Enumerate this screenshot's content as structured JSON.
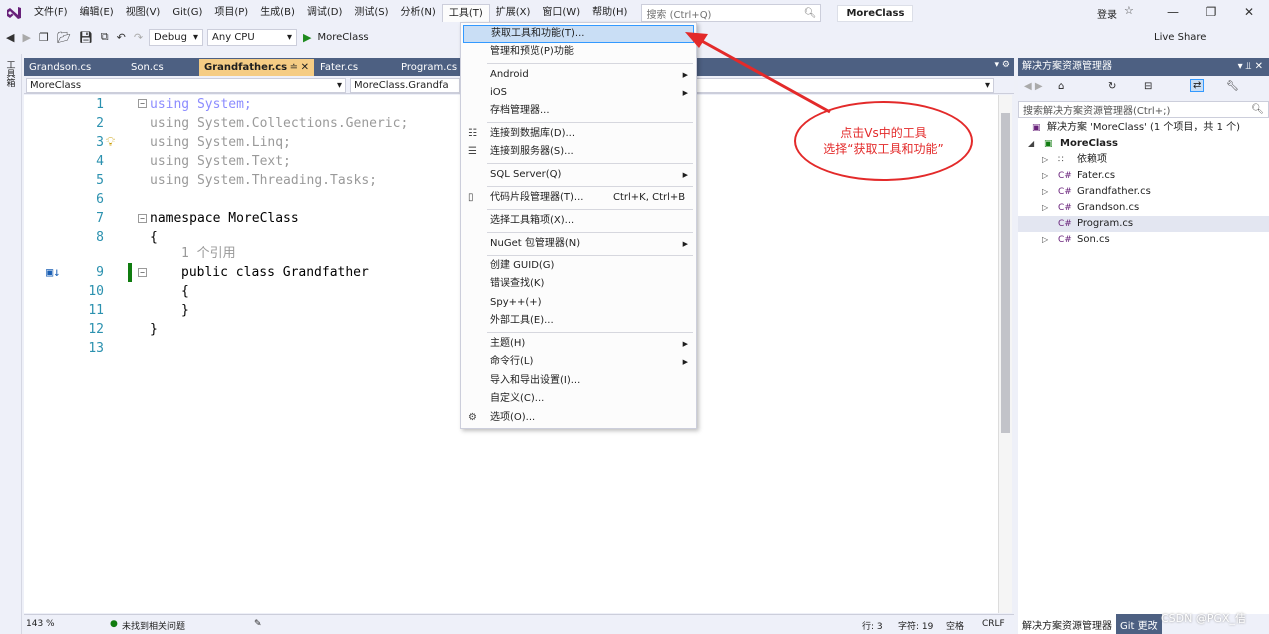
{
  "menubar": {
    "items": [
      "文件(F)",
      "编辑(E)",
      "视图(V)",
      "Git(G)",
      "项目(P)",
      "生成(B)",
      "调试(D)",
      "测试(S)",
      "分析(N)",
      "工具(T)",
      "扩展(X)",
      "窗口(W)",
      "帮助(H)"
    ],
    "search_placeholder": "搜索 (Ctrl+Q)",
    "solution_name": "MoreClass",
    "login": "登录"
  },
  "toolbar": {
    "config": "Debug",
    "platform": "Any CPU",
    "run_target": "MoreClass",
    "live_share": "Live Share"
  },
  "left_strip": {
    "label": "工具箱"
  },
  "editor": {
    "tabs": [
      "Grandson.cs",
      "Son.cs",
      "Grandfather.cs",
      "Fater.cs",
      "Program.cs"
    ],
    "active_tab": "Grandfather.cs",
    "nav_left": "MoreClass",
    "nav_middle": "MoreClass.Grandfa",
    "lines": [
      {
        "no": "1",
        "text": "using System;"
      },
      {
        "no": "2",
        "text": "using System.Collections.Generic;"
      },
      {
        "no": "3",
        "text": "using System.Linq;"
      },
      {
        "no": "4",
        "text": "using System.Text;"
      },
      {
        "no": "5",
        "text": "using System.Threading.Tasks;"
      },
      {
        "no": "6",
        "text": ""
      },
      {
        "no": "7",
        "text": "namespace MoreClass"
      },
      {
        "no": "8",
        "text": "{"
      },
      {
        "no": "",
        "text": "1 个引用"
      },
      {
        "no": "9",
        "text": "public class Grandfather"
      },
      {
        "no": "10",
        "text": "{"
      },
      {
        "no": "11",
        "text": "}"
      },
      {
        "no": "12",
        "text": "}"
      },
      {
        "no": "13",
        "text": ""
      }
    ]
  },
  "status": {
    "zoom": "143 %",
    "issues": "未找到相关问题",
    "line": "行: 3",
    "col": "字符: 19",
    "spaces": "空格",
    "eol": "CRLF"
  },
  "solution_explorer": {
    "title": "解决方案资源管理器",
    "search_placeholder": "搜索解决方案资源管理器(Ctrl+;)",
    "tree": [
      {
        "label": "解决方案 'MoreClass' (1 个项目，共 1 个)",
        "level": 0
      },
      {
        "label": "MoreClass",
        "level": 1
      },
      {
        "label": "依赖项",
        "level": 2
      },
      {
        "label": "Fater.cs",
        "level": 2
      },
      {
        "label": "Grandfather.cs",
        "level": 2
      },
      {
        "label": "Grandson.cs",
        "level": 2
      },
      {
        "label": "Program.cs",
        "level": 2
      },
      {
        "label": "Son.cs",
        "level": 2
      }
    ],
    "bottom_tabs": [
      "解决方案资源管理器",
      "Git 更改"
    ]
  },
  "tools_menu": {
    "items": [
      {
        "label": "获取工具和功能(T)...",
        "shortcut": "",
        "submenu": false
      },
      {
        "label": "管理和预览(P)功能",
        "shortcut": "",
        "submenu": false
      },
      {
        "label": "Android",
        "shortcut": "",
        "submenu": true
      },
      {
        "label": "iOS",
        "shortcut": "",
        "submenu": true
      },
      {
        "label": "存档管理器...",
        "shortcut": "",
        "submenu": false
      },
      {
        "label": "连接到数据库(D)...",
        "shortcut": "",
        "submenu": false
      },
      {
        "label": "连接到服务器(S)...",
        "shortcut": "",
        "submenu": false
      },
      {
        "label": "SQL Server(Q)",
        "shortcut": "",
        "submenu": true
      },
      {
        "label": "代码片段管理器(T)...",
        "shortcut": "Ctrl+K, Ctrl+B",
        "submenu": false
      },
      {
        "label": "选择工具箱项(X)...",
        "shortcut": "",
        "submenu": false
      },
      {
        "label": "NuGet 包管理器(N)",
        "shortcut": "",
        "submenu": true
      },
      {
        "label": "创建 GUID(G)",
        "shortcut": "",
        "submenu": false
      },
      {
        "label": "错误查找(K)",
        "shortcut": "",
        "submenu": false
      },
      {
        "label": "Spy++(+)",
        "shortcut": "",
        "submenu": false
      },
      {
        "label": "外部工具(E)...",
        "shortcut": "",
        "submenu": false
      },
      {
        "label": "主题(H)",
        "shortcut": "",
        "submenu": true
      },
      {
        "label": "命令行(L)",
        "shortcut": "",
        "submenu": true
      },
      {
        "label": "导入和导出设置(I)...",
        "shortcut": "",
        "submenu": false
      },
      {
        "label": "自定义(C)...",
        "shortcut": "",
        "submenu": false
      },
      {
        "label": "选项(O)...",
        "shortcut": "",
        "submenu": false
      }
    ]
  },
  "annotation": {
    "line1": "点击Vs中的工具",
    "line2": "选择“获取工具和功能”"
  },
  "watermark": "CSDN @PGX_佶",
  "colors": {
    "accent": "#4d6082",
    "active_tab": "#f5cc84",
    "annotation": "#e32a2a",
    "highlight": "#c9def5"
  }
}
